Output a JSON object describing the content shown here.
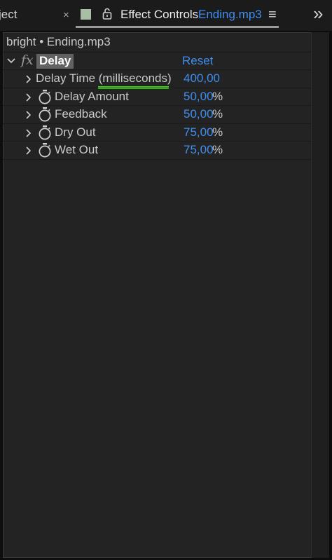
{
  "tabs": {
    "project_label": "ject",
    "close_glyph": "×",
    "active_label": "Effect Controls",
    "active_clip": "Ending.mp3",
    "menu_glyph": "≡",
    "overflow_glyph": "»"
  },
  "panel": {
    "breadcrumb": "bright • Ending.mp3",
    "effect": {
      "fx_glyph": "fx",
      "name": "Delay",
      "reset_label": "Reset"
    },
    "params": [
      {
        "label_main": "Delay Time ",
        "label_unit": "(milliseconds)",
        "value": "400,00",
        "unit": ""
      },
      {
        "label_main": "Delay Amount",
        "value": "50,00",
        "unit": "%"
      },
      {
        "label_main": "Feedback",
        "value": "50,00",
        "unit": "%"
      },
      {
        "label_main": "Dry Out",
        "value": "75,00",
        "unit": "%"
      },
      {
        "label_main": "Wet Out",
        "value": "75,00",
        "unit": "%"
      }
    ]
  },
  "colors": {
    "value_blue": "#3f8ef0",
    "annotation_green": "#35e000",
    "label_swatch": "#a7bfa5"
  }
}
